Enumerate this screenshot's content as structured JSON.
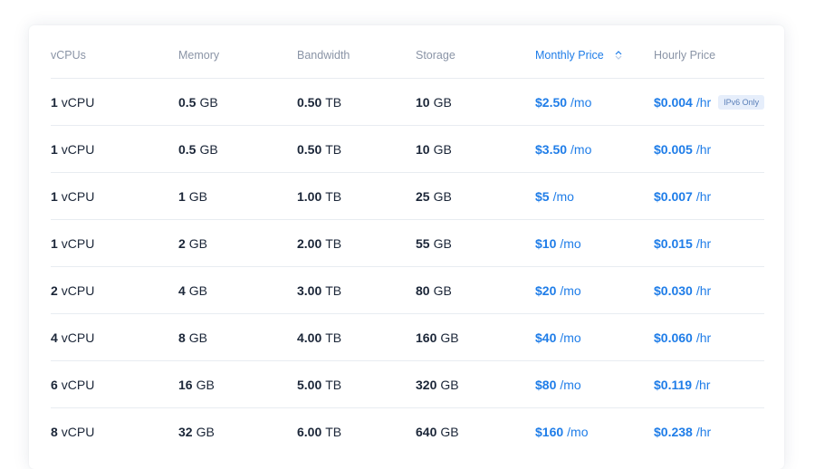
{
  "colors": {
    "accent": "#1f7de8",
    "text": "#1b2638",
    "muted": "#8a94a6",
    "divider": "#e8ecf1",
    "badge_bg": "#e6eefb"
  },
  "table": {
    "headers": {
      "vcpus": "vCPUs",
      "memory": "Memory",
      "bandwidth": "Bandwidth",
      "storage": "Storage",
      "monthly": "Monthly Price",
      "hourly": "Hourly Price"
    },
    "sort": {
      "column": "Monthly Price",
      "icon": "sort-icon"
    },
    "rows": [
      {
        "vcpu": "1",
        "vcpu_unit": "vCPU",
        "mem": "0.5",
        "mem_unit": "GB",
        "bw": "0.50",
        "bw_unit": "TB",
        "sto": "10",
        "sto_unit": "GB",
        "monthly": "$2.50",
        "monthly_unit": "/mo",
        "hourly": "$0.004",
        "hourly_unit": "/hr",
        "badge": "IPv6 Only"
      },
      {
        "vcpu": "1",
        "vcpu_unit": "vCPU",
        "mem": "0.5",
        "mem_unit": "GB",
        "bw": "0.50",
        "bw_unit": "TB",
        "sto": "10",
        "sto_unit": "GB",
        "monthly": "$3.50",
        "monthly_unit": "/mo",
        "hourly": "$0.005",
        "hourly_unit": "/hr"
      },
      {
        "vcpu": "1",
        "vcpu_unit": "vCPU",
        "mem": "1",
        "mem_unit": "GB",
        "bw": "1.00",
        "bw_unit": "TB",
        "sto": "25",
        "sto_unit": "GB",
        "monthly": "$5",
        "monthly_unit": "/mo",
        "hourly": "$0.007",
        "hourly_unit": "/hr"
      },
      {
        "vcpu": "1",
        "vcpu_unit": "vCPU",
        "mem": "2",
        "mem_unit": "GB",
        "bw": "2.00",
        "bw_unit": "TB",
        "sto": "55",
        "sto_unit": "GB",
        "monthly": "$10",
        "monthly_unit": "/mo",
        "hourly": "$0.015",
        "hourly_unit": "/hr"
      },
      {
        "vcpu": "2",
        "vcpu_unit": "vCPU",
        "mem": "4",
        "mem_unit": "GB",
        "bw": "3.00",
        "bw_unit": "TB",
        "sto": "80",
        "sto_unit": "GB",
        "monthly": "$20",
        "monthly_unit": "/mo",
        "hourly": "$0.030",
        "hourly_unit": "/hr"
      },
      {
        "vcpu": "4",
        "vcpu_unit": "vCPU",
        "mem": "8",
        "mem_unit": "GB",
        "bw": "4.00",
        "bw_unit": "TB",
        "sto": "160",
        "sto_unit": "GB",
        "monthly": "$40",
        "monthly_unit": "/mo",
        "hourly": "$0.060",
        "hourly_unit": "/hr"
      },
      {
        "vcpu": "6",
        "vcpu_unit": "vCPU",
        "mem": "16",
        "mem_unit": "GB",
        "bw": "5.00",
        "bw_unit": "TB",
        "sto": "320",
        "sto_unit": "GB",
        "monthly": "$80",
        "monthly_unit": "/mo",
        "hourly": "$0.119",
        "hourly_unit": "/hr"
      },
      {
        "vcpu": "8",
        "vcpu_unit": "vCPU",
        "mem": "32",
        "mem_unit": "GB",
        "bw": "6.00",
        "bw_unit": "TB",
        "sto": "640",
        "sto_unit": "GB",
        "monthly": "$160",
        "monthly_unit": "/mo",
        "hourly": "$0.238",
        "hourly_unit": "/hr"
      }
    ]
  }
}
